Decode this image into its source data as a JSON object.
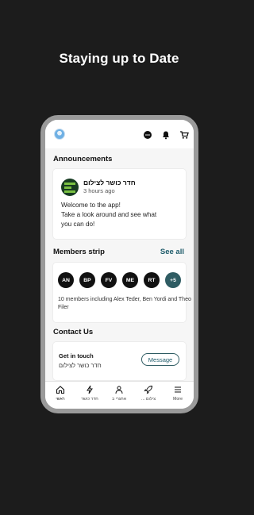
{
  "headline": "Staying up to Date",
  "topbar": {
    "avatar": "user-avatar",
    "icons": [
      "chat-icon",
      "bell-icon",
      "cart-icon"
    ]
  },
  "announcements": {
    "title": "Announcements",
    "post": {
      "author": "חדר כושר לצילום",
      "time": "3 hours ago",
      "lines": [
        "Welcome to the app!",
        "Take a look around and see what",
        "you can do!"
      ]
    }
  },
  "members": {
    "title": "Members strip",
    "see_all": "See all",
    "chips": [
      "AN",
      "BP",
      "FV",
      "ME",
      "RT",
      "+5"
    ],
    "description": "10 members including Alex Teder, Ben Yordi and Theo Filer"
  },
  "contact": {
    "title": "Contact Us",
    "label": "Get in touch",
    "subtitle": "חדר כושר לצילום",
    "button": "Message"
  },
  "tabbar": {
    "tabs": [
      {
        "label": "ראשי",
        "icon": "home-icon"
      },
      {
        "label": "חדר כושר",
        "icon": "lightning-icon"
      },
      {
        "label": "אתגרי ב",
        "icon": "people-icon"
      },
      {
        "label": "... צילום",
        "icon": "rocket-icon"
      },
      {
        "label": "More",
        "icon": "menu-icon"
      }
    ]
  }
}
